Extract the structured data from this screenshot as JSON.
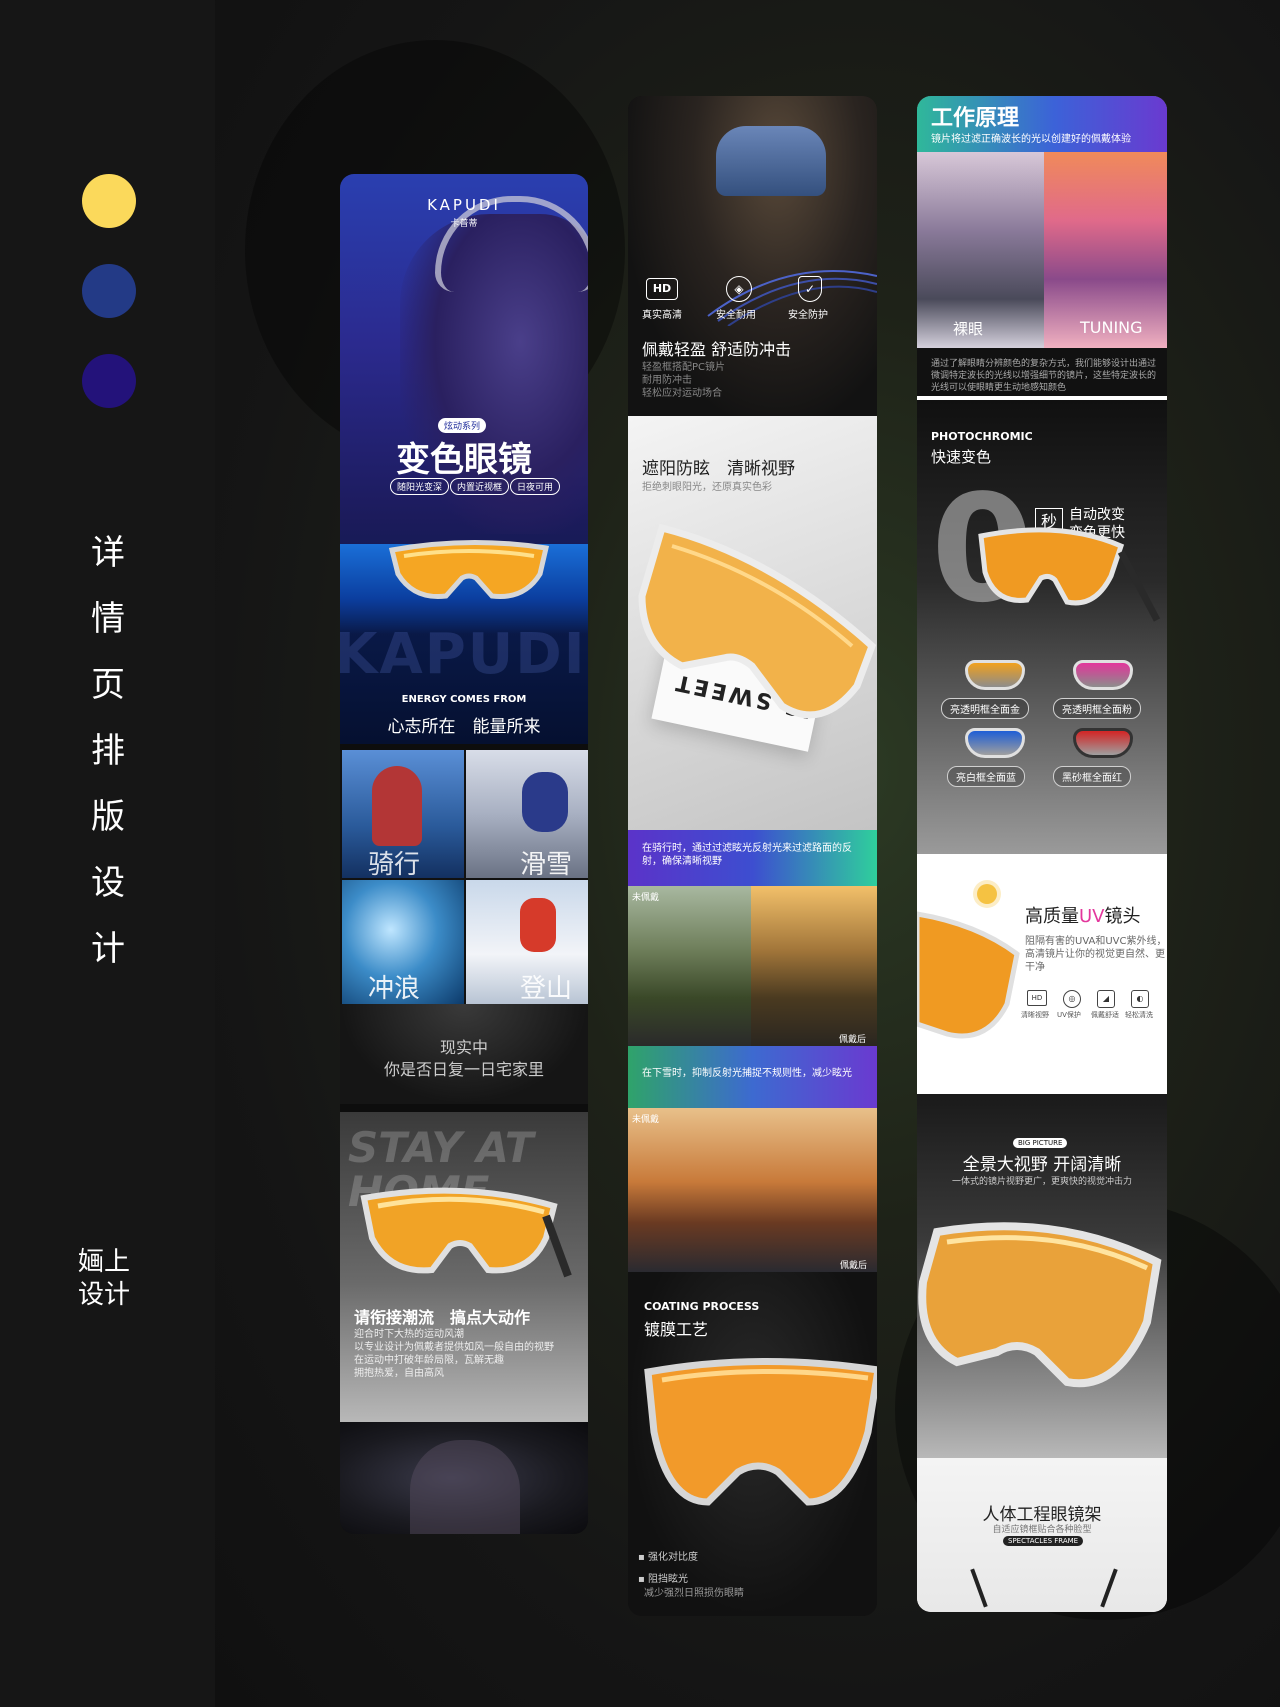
{
  "sidebar": {
    "dot_colors": [
      "#fbd95b",
      "#233a86",
      "#23127a"
    ],
    "title_chars": [
      "详",
      "情",
      "页",
      "排",
      "版",
      "设",
      "计"
    ],
    "credit_lines": [
      "婳上",
      "设计"
    ]
  },
  "col1": {
    "brand": "KAPUDI",
    "brand_cn": "卡普蒂",
    "series_tag": "炫动系列",
    "hero_title": "变色眼镜",
    "chips": [
      "随阳光变深",
      "内置近视框",
      "日夜可用"
    ],
    "watermark": "KAPUDI",
    "energy_en": "ENERGY COMES FROM",
    "energy_cn": "心志所在　能量所来",
    "sports": [
      "骑行",
      "滑雪",
      "冲浪",
      "登山"
    ],
    "reality_l1": "现实中",
    "reality_l2": "你是否日复一日宅家里",
    "stay_text": "STAY AT HOME",
    "street_title": "请衔接潮流　搞点大动作",
    "street_desc": [
      "迎合时下大热的运动风潮",
      "以专业设计为佩戴者提供如风一般自由的视野",
      "在运动中打破年龄局限，瓦解无趣",
      "拥抱热爱，自由高风"
    ]
  },
  "col2": {
    "icons": [
      {
        "label": "真实高清",
        "glyph": "HD"
      },
      {
        "label": "安全耐用",
        "glyph": "◈"
      },
      {
        "label": "安全防护",
        "glyph": "✓"
      }
    ],
    "feature_title": "佩戴轻盈 舒适防冲击",
    "feature_desc": [
      "轻盈框搭配PC镜片",
      "耐用防冲击",
      "轻松应对运动场合"
    ],
    "sun_title": "遮阳防眩　清晰视野",
    "sun_sub": "拒绝刺眼阳光，还原真实色彩",
    "box_text": "IS SWEET",
    "riding_banner": "在骑行时，通过过滤眩光反射光来过滤路面的反射，确保清晰视野",
    "before_label": "未佩戴",
    "after_label": "佩戴后",
    "snow_banner": "在下雪时，抑制反射光捕捉不规则性，减少眩光",
    "coating_en": "COATING PROCESS",
    "coating_cn": "镀膜工艺",
    "bullets": [
      {
        "title": "强化对比度",
        "desc": ""
      },
      {
        "title": "阻挡眩光",
        "desc": "减少强烈日照损伤眼睛"
      }
    ]
  },
  "col3": {
    "principle_title": "工作原理",
    "principle_sub": "镜片将过滤正确波长的光以创建好的佩戴体验",
    "left_label": "裸眼",
    "right_label": "TUNING",
    "principle_desc": "通过了解眼睛分辨颜色的复杂方式，我们能够设计出通过微调特定波长的光线以增强细节的镜片，这些特定波长的光线可以使眼睛更生动地感知颜色",
    "photo_en": "PHOTOCHROMIC",
    "photo_cn": "快速变色",
    "big_digit": "0",
    "sec_glyph": "秒",
    "auto_l1": "自动改变",
    "auto_l2": "变色更快",
    "variants": [
      {
        "label": "亮透明框全面金",
        "color": "#f2a21e"
      },
      {
        "label": "亮透明框全面粉",
        "color": "#e3379c"
      },
      {
        "label": "亮白框全面蓝",
        "color": "#1f5fd6"
      },
      {
        "label": "黑砂框全面红",
        "color": "#d42525"
      }
    ],
    "uv_title_a": "高质量",
    "uv_title_hl": "UV",
    "uv_title_b": "镜头",
    "uv_desc": [
      "阻隔有害的UVA和UVC紫外线，",
      "高清镜片让你的视觉更自然、更",
      "干净"
    ],
    "uv_icons": [
      {
        "glyph": "HD",
        "label": "清晰视野"
      },
      {
        "glyph": "◎",
        "label": "UV保护"
      },
      {
        "glyph": "◢",
        "label": "佩戴舒适"
      },
      {
        "glyph": "◐",
        "label": "轻松清洗"
      }
    ],
    "big_picture_tag": "BIG PICTURE",
    "pano_title": "全景大视野 开阔清晰",
    "pano_sub": "一体式的镜片视野更广，更爽快的视觉冲击力",
    "ergo_title": "人体工程眼镜架",
    "ergo_sub": "自适应镜框贴合各种脸型",
    "ergo_tag": "SPECTACLES FRAME"
  }
}
